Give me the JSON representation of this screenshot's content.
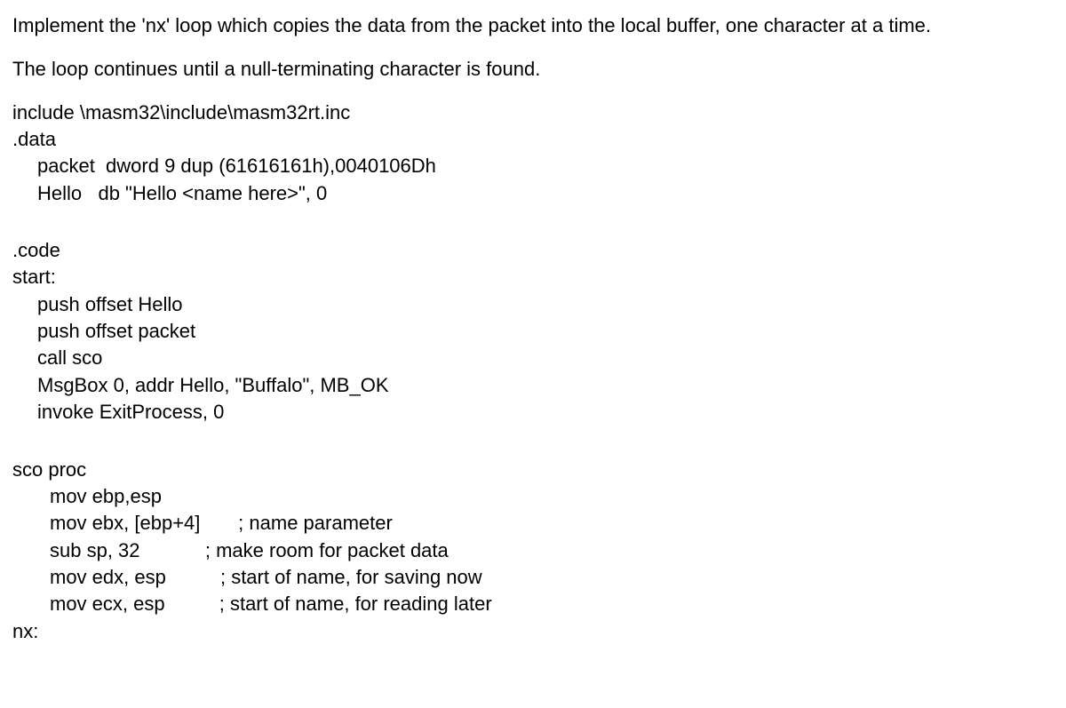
{
  "instruction": {
    "line1": "Implement the 'nx' loop which copies the data from the packet into the local buffer, one character at a time.",
    "line2": "The loop continues until a null-terminating character is found."
  },
  "code": {
    "include": "include \\masm32\\include\\masm32rt.inc",
    "data_label": ".data",
    "packet": "packet  dword 9 dup (61616161h),0040106Dh",
    "hello": "Hello   db \"Hello <name here>\", 0",
    "code_label": ".code",
    "start_label": "start:",
    "push_hello": "push offset Hello",
    "push_packet": "push offset packet",
    "call_sco": "call sco",
    "msgbox": "MsgBox 0, addr Hello, \"Buffalo\", MB_OK",
    "exit": "invoke ExitProcess, 0",
    "sco_proc": "sco proc",
    "mov_ebp": "mov ebp,esp",
    "mov_ebx": "mov ebx, [ebp+4]       ; name parameter",
    "sub_sp": "sub sp, 32            ; make room for packet data",
    "mov_edx": "mov edx, esp          ; start of name, for saving now",
    "mov_ecx": "mov ecx, esp          ; start of name, for reading later",
    "nx_label": "nx:"
  }
}
